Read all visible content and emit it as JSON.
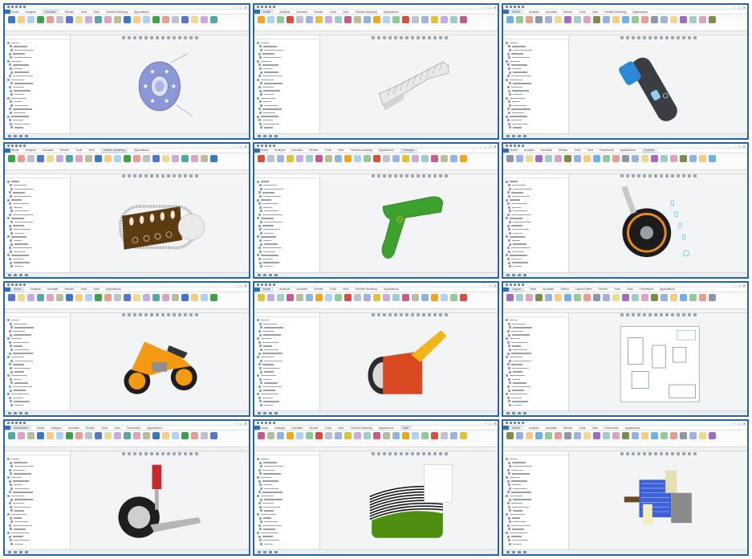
{
  "collage": {
    "window_control_glyphs": [
      "−",
      "□",
      "✕"
    ],
    "windows": [
      {
        "id": "brake-disc",
        "title": "",
        "tabs": [
          "File",
          "Model",
          "Analysis",
          "Annotate",
          "Render",
          "Tools",
          "View",
          "Flexible Modeling",
          "Applications"
        ],
        "active_tab": "Annotate",
        "subject": "brake-disc-icon",
        "color": "#8c97d8"
      },
      {
        "id": "lattice-bracket",
        "title": "",
        "tabs": [
          "File",
          "Model",
          "Analysis",
          "Annotate",
          "Render",
          "Tools",
          "View",
          "Flexible Modeling",
          "Applications"
        ],
        "active_tab": "Model",
        "subject": "lattice-part-icon",
        "color": "#e9e9e9"
      },
      {
        "id": "shaver",
        "title": "",
        "tabs": [
          "File",
          "Model",
          "Analysis",
          "Annotate",
          "Render",
          "Tools",
          "View",
          "Flexible Modeling",
          "Applications"
        ],
        "active_tab": "Model",
        "subject": "shaver-icon",
        "color": "#3a3d44"
      },
      {
        "id": "track-frame",
        "title": "",
        "tabs": [
          "File",
          "Model",
          "Analysis",
          "Annotate",
          "Render",
          "Tools",
          "View",
          "Flexible Modeling",
          "Applications"
        ],
        "active_tab": "Flexible Modeling",
        "subject": "track-frame-icon",
        "color": "#5c3a12"
      },
      {
        "id": "drill-handle",
        "title": "",
        "tabs": [
          "File",
          "Model",
          "Analysis",
          "Annotate",
          "Render",
          "Tools",
          "View",
          "Flexible Modeling",
          "Applications",
          "Freestyle"
        ],
        "active_tab": "Freestyle",
        "subject": "drill-handle-icon",
        "color": "#3da12e"
      },
      {
        "id": "wheel-assembly",
        "title": "",
        "tabs": [
          "File",
          "Model",
          "Analysis",
          "Annotate",
          "Render",
          "Tools",
          "View",
          "Framework",
          "Applications",
          "Explode"
        ],
        "active_tab": "Explode",
        "subject": "wheel-icon",
        "color": "#e88a1e"
      },
      {
        "id": "motorcycle",
        "title": "",
        "tabs": [
          "File",
          "Model",
          "Analysis",
          "Annotate",
          "Render",
          "Tools",
          "View",
          "Applications"
        ],
        "active_tab": "Model",
        "subject": "motorcycle-icon",
        "color": "#f39a12"
      },
      {
        "id": "flashlight",
        "title": "",
        "tabs": [
          "File",
          "Model",
          "Analysis",
          "Annotate",
          "Render",
          "Tools",
          "View",
          "Flexible Modeling",
          "Applications"
        ],
        "active_tab": "Model",
        "subject": "flashlight-icon",
        "color": "#d94a22"
      },
      {
        "id": "drawing",
        "title": "",
        "tabs": [
          "File",
          "Layout",
          "Table",
          "Annotate",
          "Sketch",
          "Layout Plane",
          "Review",
          "Tools",
          "View",
          "Framework",
          "Applications"
        ],
        "active_tab": "Layout",
        "subject": "drawing-sheet-icon",
        "color": "#4aa0e0"
      },
      {
        "id": "suspension",
        "title": "",
        "tabs": [
          "File",
          "Mechanism",
          "Model",
          "Analysis",
          "Annotate",
          "Render",
          "Tools",
          "View",
          "Framework",
          "Applications"
        ],
        "active_tab": "Mechanism",
        "subject": "suspension-icon",
        "color": "#c7262a"
      },
      {
        "id": "reflection-analysis",
        "title": "",
        "tabs": [
          "File",
          "Model",
          "Analysis",
          "Annotate",
          "Render",
          "Tools",
          "View",
          "Flexible Modeling",
          "Applications",
          "Style"
        ],
        "active_tab": "Style",
        "subject": "zebra-analysis-icon",
        "color": "#4e8f12"
      },
      {
        "id": "motor-assembly",
        "title": "",
        "tabs": [
          "File",
          "Model",
          "Analysis",
          "Annotate",
          "Render",
          "Tools",
          "View",
          "Framework",
          "Applications"
        ],
        "active_tab": "Model",
        "subject": "motor-assembly-icon",
        "color": "#3c62d6"
      }
    ]
  }
}
